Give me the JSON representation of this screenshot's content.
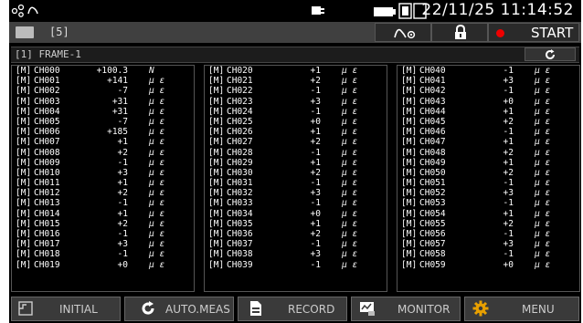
{
  "status": {
    "date_time": "22/11/25  11:14:52"
  },
  "toolbar": {
    "frame_count": "[5]",
    "start_label": "START"
  },
  "frame": {
    "title": "[1] FRAME-1"
  },
  "columns": [
    [
      {
        "tag": "[M]",
        "ch": "CH000",
        "val": "+100.3",
        "unit": "N"
      },
      {
        "tag": "[M]",
        "ch": "CH001",
        "val": "+141",
        "unit": "μ ε"
      },
      {
        "tag": "[M]",
        "ch": "CH002",
        "val": "-7",
        "unit": "μ ε"
      },
      {
        "tag": "[M]",
        "ch": "CH003",
        "val": "+31",
        "unit": "μ ε"
      },
      {
        "tag": "[M]",
        "ch": "CH004",
        "val": "+31",
        "unit": "μ ε"
      },
      {
        "tag": "[M]",
        "ch": "CH005",
        "val": "-7",
        "unit": "μ ε"
      },
      {
        "tag": "[M]",
        "ch": "CH006",
        "val": "+185",
        "unit": "μ ε"
      },
      {
        "tag": "[M]",
        "ch": "CH007",
        "val": "+1",
        "unit": "μ ε"
      },
      {
        "tag": "[M]",
        "ch": "CH008",
        "val": "+2",
        "unit": "μ ε"
      },
      {
        "tag": "[M]",
        "ch": "CH009",
        "val": "-1",
        "unit": "μ ε"
      },
      {
        "tag": "[M]",
        "ch": "CH010",
        "val": "+3",
        "unit": "μ ε"
      },
      {
        "tag": "[M]",
        "ch": "CH011",
        "val": "+1",
        "unit": "μ ε"
      },
      {
        "tag": "[M]",
        "ch": "CH012",
        "val": "+2",
        "unit": "μ ε"
      },
      {
        "tag": "[M]",
        "ch": "CH013",
        "val": "-1",
        "unit": "μ ε"
      },
      {
        "tag": "[M]",
        "ch": "CH014",
        "val": "+1",
        "unit": "μ ε"
      },
      {
        "tag": "[M]",
        "ch": "CH015",
        "val": "+2",
        "unit": "μ ε"
      },
      {
        "tag": "[M]",
        "ch": "CH016",
        "val": "-1",
        "unit": "μ ε"
      },
      {
        "tag": "[M]",
        "ch": "CH017",
        "val": "+3",
        "unit": "μ ε"
      },
      {
        "tag": "[M]",
        "ch": "CH018",
        "val": "-1",
        "unit": "μ ε"
      },
      {
        "tag": "[M]",
        "ch": "CH019",
        "val": "+0",
        "unit": "μ ε"
      }
    ],
    [
      {
        "tag": "[M]",
        "ch": "CH020",
        "val": "+1",
        "unit": "μ ε"
      },
      {
        "tag": "[M]",
        "ch": "CH021",
        "val": "+2",
        "unit": "μ ε"
      },
      {
        "tag": "[M]",
        "ch": "CH022",
        "val": "-1",
        "unit": "μ ε"
      },
      {
        "tag": "[M]",
        "ch": "CH023",
        "val": "+3",
        "unit": "μ ε"
      },
      {
        "tag": "[M]",
        "ch": "CH024",
        "val": "-1",
        "unit": "μ ε"
      },
      {
        "tag": "[M]",
        "ch": "CH025",
        "val": "+0",
        "unit": "μ ε"
      },
      {
        "tag": "[M]",
        "ch": "CH026",
        "val": "+1",
        "unit": "μ ε"
      },
      {
        "tag": "[M]",
        "ch": "CH027",
        "val": "+2",
        "unit": "μ ε"
      },
      {
        "tag": "[M]",
        "ch": "CH028",
        "val": "-1",
        "unit": "μ ε"
      },
      {
        "tag": "[M]",
        "ch": "CH029",
        "val": "+1",
        "unit": "μ ε"
      },
      {
        "tag": "[M]",
        "ch": "CH030",
        "val": "+2",
        "unit": "μ ε"
      },
      {
        "tag": "[M]",
        "ch": "CH031",
        "val": "-1",
        "unit": "μ ε"
      },
      {
        "tag": "[M]",
        "ch": "CH032",
        "val": "+3",
        "unit": "μ ε"
      },
      {
        "tag": "[M]",
        "ch": "CH033",
        "val": "-1",
        "unit": "μ ε"
      },
      {
        "tag": "[M]",
        "ch": "CH034",
        "val": "+0",
        "unit": "μ ε"
      },
      {
        "tag": "[M]",
        "ch": "CH035",
        "val": "+1",
        "unit": "μ ε"
      },
      {
        "tag": "[M]",
        "ch": "CH036",
        "val": "+2",
        "unit": "μ ε"
      },
      {
        "tag": "[M]",
        "ch": "CH037",
        "val": "-1",
        "unit": "μ ε"
      },
      {
        "tag": "[M]",
        "ch": "CH038",
        "val": "+3",
        "unit": "μ ε"
      },
      {
        "tag": "[M]",
        "ch": "CH039",
        "val": "-1",
        "unit": "μ ε"
      }
    ],
    [
      {
        "tag": "[M]",
        "ch": "CH040",
        "val": "-1",
        "unit": "μ ε"
      },
      {
        "tag": "[M]",
        "ch": "CH041",
        "val": "+3",
        "unit": "μ ε"
      },
      {
        "tag": "[M]",
        "ch": "CH042",
        "val": "-1",
        "unit": "μ ε"
      },
      {
        "tag": "[M]",
        "ch": "CH043",
        "val": "+0",
        "unit": "μ ε"
      },
      {
        "tag": "[M]",
        "ch": "CH044",
        "val": "+1",
        "unit": "μ ε"
      },
      {
        "tag": "[M]",
        "ch": "CH045",
        "val": "+2",
        "unit": "μ ε"
      },
      {
        "tag": "[M]",
        "ch": "CH046",
        "val": "-1",
        "unit": "μ ε"
      },
      {
        "tag": "[M]",
        "ch": "CH047",
        "val": "+1",
        "unit": "μ ε"
      },
      {
        "tag": "[M]",
        "ch": "CH048",
        "val": "+2",
        "unit": "μ ε"
      },
      {
        "tag": "[M]",
        "ch": "CH049",
        "val": "+1",
        "unit": "μ ε"
      },
      {
        "tag": "[M]",
        "ch": "CH050",
        "val": "+2",
        "unit": "μ ε"
      },
      {
        "tag": "[M]",
        "ch": "CH051",
        "val": "-1",
        "unit": "μ ε"
      },
      {
        "tag": "[M]",
        "ch": "CH052",
        "val": "+3",
        "unit": "μ ε"
      },
      {
        "tag": "[M]",
        "ch": "CH053",
        "val": "-1",
        "unit": "μ ε"
      },
      {
        "tag": "[M]",
        "ch": "CH054",
        "val": "+1",
        "unit": "μ ε"
      },
      {
        "tag": "[M]",
        "ch": "CH055",
        "val": "+2",
        "unit": "μ ε"
      },
      {
        "tag": "[M]",
        "ch": "CH056",
        "val": "-1",
        "unit": "μ ε"
      },
      {
        "tag": "[M]",
        "ch": "CH057",
        "val": "+3",
        "unit": "μ ε"
      },
      {
        "tag": "[M]",
        "ch": "CH058",
        "val": "-1",
        "unit": "μ ε"
      },
      {
        "tag": "[M]",
        "ch": "CH059",
        "val": "+0",
        "unit": "μ ε"
      }
    ]
  ],
  "bottom_bar": {
    "initial": "INITIAL",
    "auto_meas": "AUTO.MEAS",
    "record": "RECORD",
    "monitor": "MONITOR",
    "menu": "MENU"
  },
  "icons": {
    "network": "network-icon",
    "sensor": "sensor-icon",
    "battery": "battery-icon",
    "sd_card": "sd-card-icon",
    "lock": "lock-icon",
    "refresh": "refresh-icon",
    "initial": "initial-icon",
    "auto_meas": "auto-meas-icon",
    "record": "record-icon",
    "monitor": "monitor-icon",
    "menu": "gear-icon"
  },
  "colors": {
    "record_dot": "#e00000",
    "menu_gear": "#e8a000"
  }
}
